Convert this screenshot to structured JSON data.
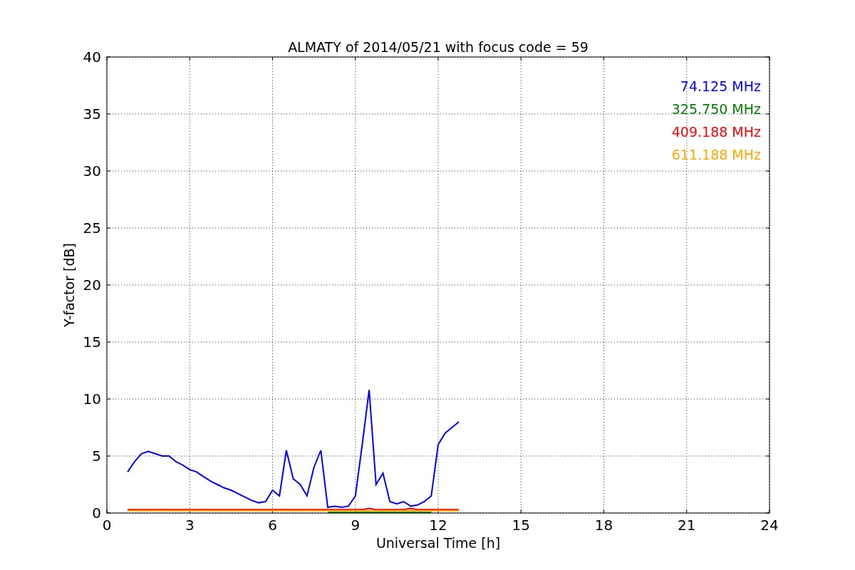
{
  "figure": {
    "chart_data": {
      "type": "line",
      "title": "ALMATY of 2014/05/21 with focus code = 59",
      "xlabel": "Universal Time [h]",
      "ylabel": "Y-factor [dB]",
      "x": [
        0.75,
        1,
        1.25,
        1.5,
        1.75,
        2,
        2.25,
        2.5,
        2.75,
        3,
        3.25,
        3.5,
        3.75,
        4,
        4.25,
        4.5,
        4.75,
        5,
        5.25,
        5.5,
        5.75,
        6,
        6.25,
        6.5,
        6.75,
        7,
        7.25,
        7.5,
        7.75,
        8,
        8.25,
        8.5,
        8.75,
        9,
        9.25,
        9.5,
        9.75,
        10,
        10.25,
        10.5,
        10.75,
        11,
        11.25,
        11.5,
        11.75,
        12,
        12.25,
        12.5,
        12.75
      ],
      "series": [
        {
          "name": "74.125 MHz",
          "color": "#0000ff",
          "values": [
            3.6,
            4.5,
            5.2,
            5.4,
            5.2,
            5.0,
            5.0,
            4.5,
            4.2,
            3.8,
            3.6,
            3.2,
            2.8,
            2.5,
            2.2,
            2.0,
            1.7,
            1.4,
            1.1,
            0.9,
            1.0,
            2.0,
            1.5,
            5.5,
            3.0,
            2.5,
            1.5,
            4.0,
            5.5,
            0.5,
            0.6,
            0.5,
            0.6,
            1.5,
            6.0,
            10.8,
            2.5,
            3.5,
            1.0,
            0.8,
            1.0,
            0.6,
            0.7,
            1.0,
            1.5,
            6.0,
            7.0,
            7.5,
            8.0
          ]
        },
        {
          "name": "325.750 MHz",
          "color": "#008000",
          "values": [
            null,
            null,
            null,
            null,
            null,
            null,
            null,
            null,
            null,
            null,
            null,
            null,
            null,
            null,
            null,
            null,
            null,
            null,
            null,
            null,
            null,
            null,
            null,
            null,
            null,
            null,
            null,
            null,
            null,
            0.05,
            0.05,
            0.05,
            0.05,
            0.05,
            0.05,
            0.05,
            0.05,
            0.05,
            0.05,
            0.05,
            0.05,
            0.05,
            0.05,
            0.05,
            0.05,
            null,
            null,
            null,
            null
          ]
        },
        {
          "name": "409.188 MHz",
          "color": "#ff0000",
          "values": [
            0.3,
            0.3,
            0.3,
            0.3,
            0.3,
            0.3,
            0.3,
            0.3,
            0.3,
            0.3,
            0.3,
            0.3,
            0.3,
            0.3,
            0.3,
            0.3,
            0.3,
            0.3,
            0.3,
            0.3,
            0.3,
            0.3,
            0.3,
            0.3,
            0.3,
            0.3,
            0.3,
            0.3,
            0.3,
            0.3,
            0.3,
            0.3,
            0.3,
            0.3,
            0.3,
            0.4,
            0.3,
            0.3,
            0.3,
            0.3,
            0.3,
            0.4,
            0.3,
            0.3,
            0.3,
            0.3,
            0.3,
            0.3,
            0.3
          ]
        },
        {
          "name": "611.188 MHz",
          "color": "#ffa500",
          "values": [
            0.2,
            0.2,
            0.2,
            0.2,
            0.2,
            0.2,
            0.2,
            0.2,
            0.2,
            0.2,
            0.2,
            0.2,
            0.2,
            0.2,
            0.2,
            0.2,
            0.2,
            0.2,
            0.2,
            0.2,
            0.2,
            0.2,
            0.2,
            0.2,
            0.2,
            0.2,
            0.2,
            0.2,
            0.2,
            0.2,
            0.2,
            0.2,
            0.2,
            0.2,
            0.2,
            0.2,
            0.2,
            0.2,
            0.2,
            0.2,
            0.2,
            0.2,
            0.2,
            0.2,
            0.2,
            0.2,
            0.2,
            0.2,
            0.2
          ]
        }
      ],
      "xlim": [
        0,
        24
      ],
      "ylim": [
        0,
        40
      ],
      "xticks": [
        0,
        3,
        6,
        9,
        12,
        15,
        18,
        21,
        24
      ],
      "yticks": [
        0,
        5,
        10,
        15,
        20,
        25,
        30,
        35,
        40
      ],
      "grid": true
    }
  }
}
